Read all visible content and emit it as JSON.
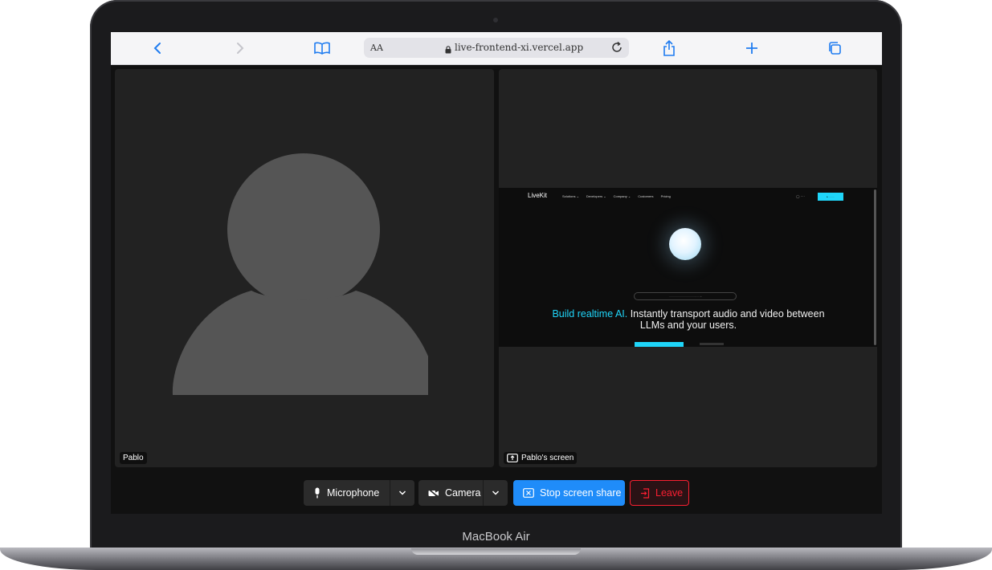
{
  "device": {
    "label": "MacBook Air"
  },
  "browser": {
    "text_size_label": "AA",
    "url": "live-frontend-xi.vercel.app",
    "icons": [
      "back-icon",
      "forward-icon",
      "bookmarks-icon",
      "lock-icon",
      "reload-icon",
      "share-icon",
      "new-tab-icon",
      "tabs-icon"
    ]
  },
  "participants": [
    {
      "name": "Pablo",
      "kind": "camera",
      "icon": "avatar-placeholder-icon"
    },
    {
      "name": "Pablo's screen",
      "kind": "screen_share",
      "icon": "screen-share-icon"
    }
  ],
  "shared_screen": {
    "logo": "LiveKit",
    "nav": [
      "Solutions ⌄",
      "Developers ⌄",
      "Company ⌄",
      "Customers",
      "Pricing"
    ],
    "headline_accent": "Build realtime AI.",
    "headline_rest": " Instantly transport audio and video between LLMs and your users.",
    "accent_color": "#1fd5f9"
  },
  "controls": {
    "microphone_label": "Microphone",
    "camera_label": "Camera",
    "stop_share_label": "Stop screen share",
    "leave_label": "Leave",
    "colors": {
      "primary": "#1f8cf9",
      "danger": "#f91f31",
      "button_bg": "#2b2b2b"
    }
  }
}
